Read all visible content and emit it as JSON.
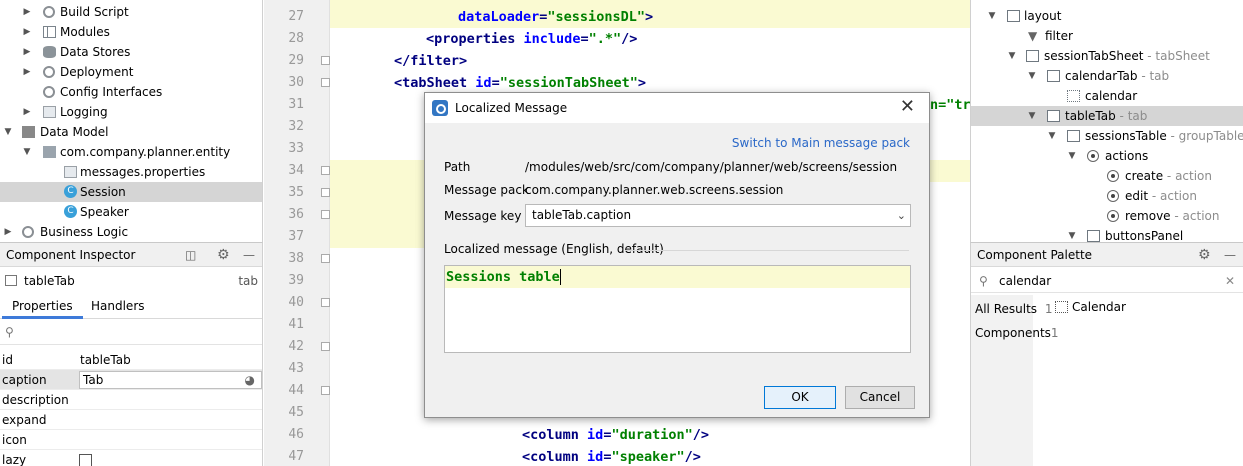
{
  "left_tree": {
    "items": [
      {
        "label": "Build Script",
        "icon": "gear-icon"
      },
      {
        "label": "Modules",
        "icon": "modules-icon"
      },
      {
        "label": "Data Stores",
        "icon": "database-icon"
      },
      {
        "label": "Deployment",
        "icon": "gear-icon"
      },
      {
        "label": "Config Interfaces",
        "icon": "gear-icon"
      },
      {
        "label": "Logging",
        "icon": "file-icon"
      },
      {
        "label": "Data Model",
        "icon": "data-model-icon"
      },
      {
        "label": "com.company.planner.entity",
        "icon": "package-icon"
      },
      {
        "label": "messages.properties",
        "icon": "properties-icon"
      },
      {
        "label": "Session",
        "icon": "class-icon"
      },
      {
        "label": "Speaker",
        "icon": "class-icon"
      },
      {
        "label": "Business Logic",
        "icon": "gear-icon"
      }
    ]
  },
  "inspector": {
    "title": "Component Inspector",
    "component_name": "tableTab",
    "component_type": "tab",
    "tabs": [
      "Properties",
      "Handlers"
    ],
    "search_placeholder": "",
    "properties": [
      {
        "name": "id",
        "value": "tableTab"
      },
      {
        "name": "caption",
        "value": "Tab"
      },
      {
        "name": "description",
        "value": ""
      },
      {
        "name": "expand",
        "value": ""
      },
      {
        "name": "icon",
        "value": ""
      },
      {
        "name": "lazy",
        "value": ""
      }
    ]
  },
  "editor": {
    "line_numbers": [
      "27",
      "28",
      "29",
      "30",
      "31",
      "32",
      "33",
      "34",
      "35",
      "36",
      "37",
      "38",
      "39",
      "40",
      "41",
      "42",
      "43",
      "44",
      "45",
      "46",
      "47"
    ],
    "line27": {
      "attr": "dataLoader",
      "eq": "=",
      "val": "\"sessionsDL\"",
      "close": ">"
    },
    "line28": {
      "open": "<properties",
      "attr": "include",
      "eq": "=",
      "val": "\".*\"",
      "close": "/>"
    },
    "line29": {
      "text": "</filter>"
    },
    "line30": {
      "open": "<tabSheet",
      "attr": "id",
      "eq": "=",
      "val": "\"sessionTabSheet\"",
      "close": ">"
    },
    "line31_tail": "n=\"tr",
    "line46": {
      "open": "<column",
      "attr": "id",
      "eq": "=",
      "val": "\"duration\"",
      "close": "/>"
    },
    "line47": {
      "open": "<column",
      "attr": "id",
      "eq": "=",
      "val": "\"speaker\"",
      "close": "/>"
    },
    "line45_tail": "/"
  },
  "structure": {
    "items": [
      {
        "label": "layout",
        "kind": ""
      },
      {
        "label": "filter",
        "kind": ""
      },
      {
        "label": "sessionTabSheet",
        "kind": "- tabSheet"
      },
      {
        "label": "calendarTab",
        "kind": "- tab"
      },
      {
        "label": "calendar",
        "kind": ""
      },
      {
        "label": "tableTab",
        "kind": "- tab"
      },
      {
        "label": "sessionsTable",
        "kind": "- groupTable"
      },
      {
        "label": "actions",
        "kind": ""
      },
      {
        "label": "create",
        "kind": "- action"
      },
      {
        "label": "edit",
        "kind": "- action"
      },
      {
        "label": "remove",
        "kind": "- action"
      },
      {
        "label": "buttonsPanel",
        "kind": ""
      }
    ]
  },
  "palette": {
    "title": "Component Palette",
    "search_value": "calendar",
    "categories": [
      {
        "label": "All Results",
        "count": "1"
      },
      {
        "label": "Components",
        "count": "1"
      }
    ],
    "result": "Calendar"
  },
  "dialog": {
    "title": "Localized Message",
    "switch_link": "Switch to Main message pack",
    "path_label": "Path",
    "path_value": "/modules/web/src/com/company/planner/web/screens/session",
    "pack_label": "Message pack",
    "pack_value": "com.company.planner.web.screens.session",
    "key_label": "Message key",
    "key_value": "tableTab.caption",
    "localized_label": "Localized message (English, default)",
    "message_text": "Sessions table",
    "ok_label": "OK",
    "cancel_label": "Cancel"
  }
}
